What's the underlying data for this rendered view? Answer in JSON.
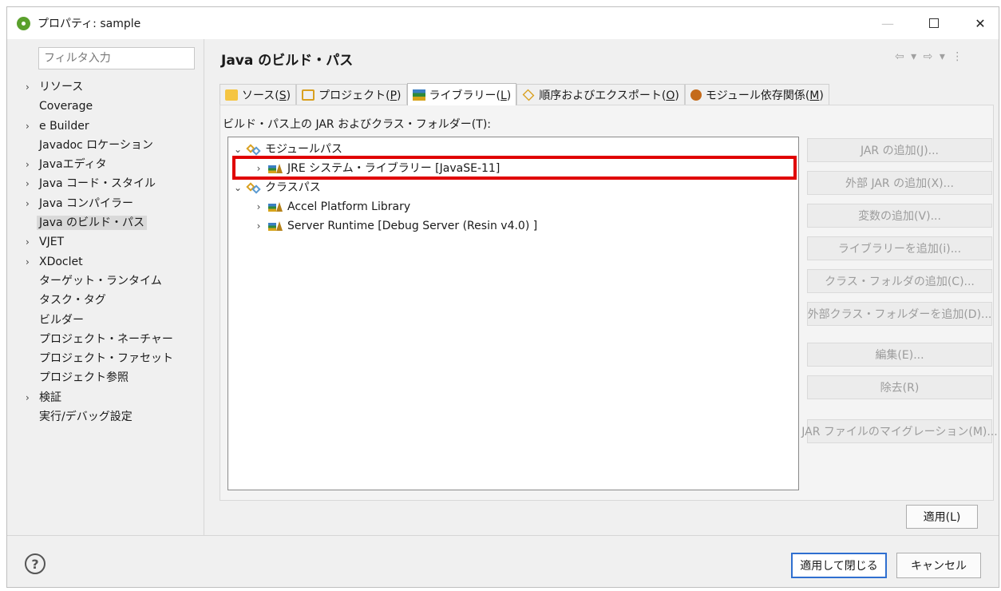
{
  "window": {
    "title": "プロパティ: sample",
    "minimize": "—",
    "close": "✕"
  },
  "sidebar": {
    "filter_placeholder": "フィルタ入力",
    "items": [
      {
        "label": "リソース",
        "expandable": true
      },
      {
        "label": "Coverage",
        "expandable": false
      },
      {
        "label": "e Builder",
        "expandable": true
      },
      {
        "label": "Javadoc ロケーション",
        "expandable": false
      },
      {
        "label": "Javaエディタ",
        "expandable": true
      },
      {
        "label": "Java コード・スタイル",
        "expandable": true
      },
      {
        "label": "Java コンパイラー",
        "expandable": true
      },
      {
        "label": "Java のビルド・パス",
        "expandable": false,
        "selected": true
      },
      {
        "label": "VJET",
        "expandable": true
      },
      {
        "label": "XDoclet",
        "expandable": true
      },
      {
        "label": "ターゲット・ランタイム",
        "expandable": false
      },
      {
        "label": "タスク・タグ",
        "expandable": false
      },
      {
        "label": "ビルダー",
        "expandable": false
      },
      {
        "label": "プロジェクト・ネーチャー",
        "expandable": false
      },
      {
        "label": "プロジェクト・ファセット",
        "expandable": false
      },
      {
        "label": "プロジェクト参照",
        "expandable": false
      },
      {
        "label": "検証",
        "expandable": true
      },
      {
        "label": "実行/デバッグ設定",
        "expandable": false
      }
    ]
  },
  "main": {
    "title": "Java のビルド・パス",
    "nav_arrows": "⇦ ▾ ⇨ ▾ ⋮",
    "tabs": [
      {
        "label": "ソース(",
        "mnemonic": "S",
        "suffix": ")",
        "icon": "source-folder-icon"
      },
      {
        "label": "プロジェクト(",
        "mnemonic": "P",
        "suffix": ")",
        "icon": "project-folder-icon"
      },
      {
        "label": "ライブラリー(",
        "mnemonic": "L",
        "suffix": ")",
        "icon": "library-icon",
        "active": true
      },
      {
        "label": "順序およびエクスポート(",
        "mnemonic": "O",
        "suffix": ")",
        "icon": "order-export-icon"
      },
      {
        "label": "モジュール依存関係(",
        "mnemonic": "M",
        "suffix": ")",
        "icon": "module-dependency-icon"
      }
    ],
    "section_label": "ビルド・パス上の JAR およびクラス・フォルダー(T):",
    "tree": {
      "module_path": "モジュールパス",
      "jre_library": "JRE システム・ライブラリー [JavaSE-11]",
      "class_path": "クラスパス",
      "accel_library": "Accel Platform Library",
      "server_runtime": "Server Runtime [Debug Server (Resin v4.0) ]"
    },
    "buttons": {
      "add_jar": "JAR の追加(J)...",
      "add_external_jar": "外部 JAR の追加(X)...",
      "add_variable": "変数の追加(V)...",
      "add_library": "ライブラリーを追加(i)...",
      "add_class_folder": "クラス・フォルダの追加(C)...",
      "add_external_class_folder": "外部クラス・フォルダーを追加(D)...",
      "edit": "編集(E)...",
      "remove": "除去(R)",
      "migrate_jar": "JAR ファイルのマイグレーション(M)..."
    },
    "apply": "適用(L)"
  },
  "footer": {
    "help": "?",
    "apply_and_close": "適用して閉じる",
    "cancel": "キャンセル"
  },
  "colors": {
    "highlight": "#e00000",
    "default_button_border": "#2f6fd0",
    "selection_bg": "#d9d9d9"
  }
}
